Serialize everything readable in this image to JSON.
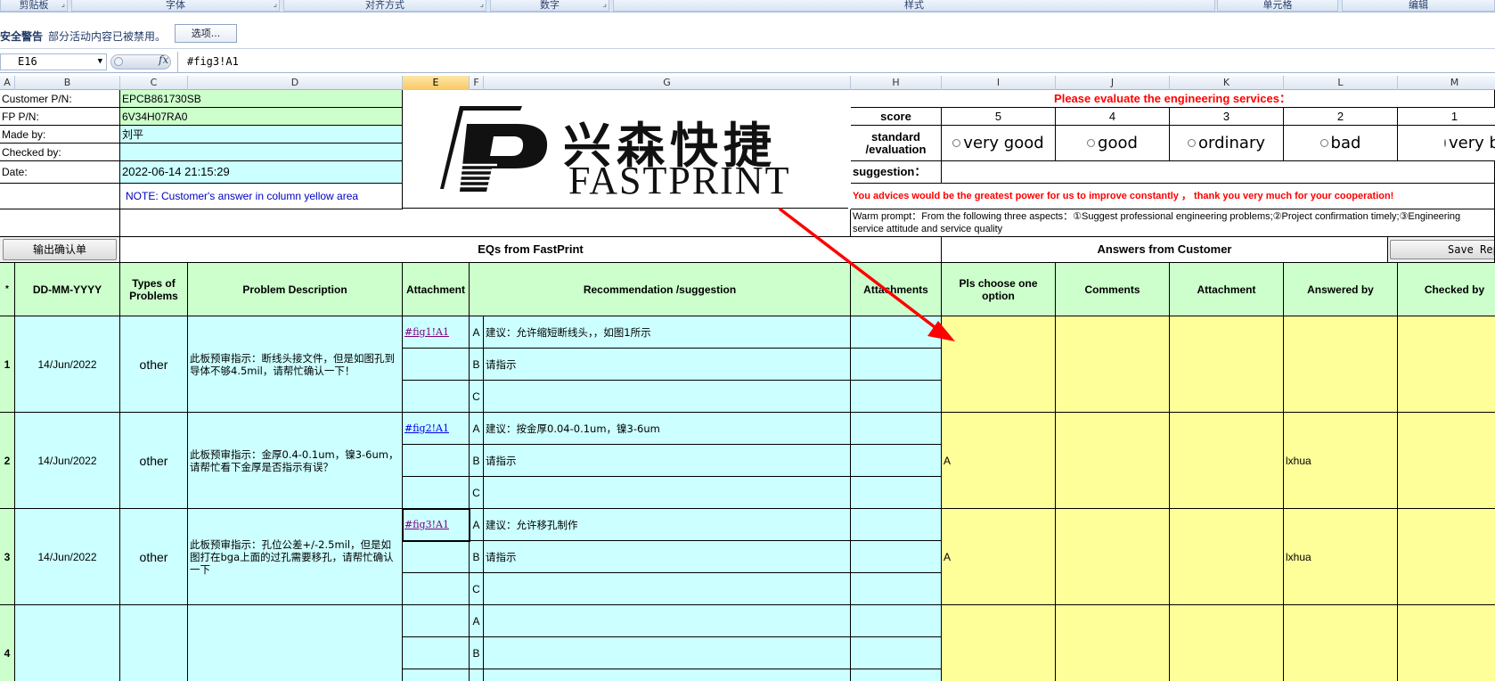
{
  "ribbon": {
    "groups": [
      "剪贴板",
      "字体",
      "对齐方式",
      "数字",
      "样式",
      "单元格",
      "编辑"
    ]
  },
  "security": {
    "title": "安全警告",
    "message": "部分活动内容已被禁用。",
    "options_label": "选项..."
  },
  "formula_bar": {
    "name_box": "E16",
    "fx": "fx",
    "formula": "#fig3!A1"
  },
  "columns": [
    "A",
    "B",
    "C",
    "D",
    "E",
    "F",
    "G",
    "H",
    "I",
    "J",
    "K",
    "L",
    "M"
  ],
  "selected_column": "E",
  "header_info": {
    "customer_pn_label": "Customer P/N:",
    "customer_pn": "EPCB861730SB",
    "fp_pn_label": "FP P/N:",
    "fp_pn": "6V34H07RA0",
    "made_by_label": "Made by:",
    "made_by": "刘平",
    "checked_by_label": "Checked by:",
    "checked_by": "",
    "date_label": "Date:",
    "date": "2022-06-14 21:15:29",
    "note": "NOTE: Customer's  answer in column yellow area"
  },
  "logo": {
    "zh": "兴森快捷",
    "en": "FASTPRINT"
  },
  "evaluation": {
    "title": "Please evaluate the engineering services：",
    "score_label": "score",
    "standard_label": "standard /evaluation",
    "scores": [
      "5",
      "4",
      "3",
      "2",
      "1"
    ],
    "options": [
      "very good",
      "good",
      "ordinary",
      "bad",
      "very bad"
    ],
    "suggestion_label": "suggestion：",
    "advice": "You advices would be the greatest power for us to improve constantly ， thank you very much for your cooperation!",
    "warm_prompt": "Warm prompt：From the following three aspects：①Suggest professional engineering problems;②Project confirmation timely;③Engineering service attitude and service quality"
  },
  "buttons": {
    "export": "输出确认单",
    "save_reply": "Save Reply"
  },
  "sections": {
    "eqs": "EQs from FastPrint",
    "answers": "Answers from Customer"
  },
  "table_headers": {
    "no": "*",
    "date": "DD-MM-YYYY",
    "types": "Types of Problems",
    "problem": "Problem Description",
    "attachment": "Attachment",
    "recommendation": "Recommendation /suggestion",
    "attachments": "Attachments",
    "choose": "Pls choose one option",
    "comments": "Comments",
    "attachment2": "Attachment",
    "answered_by": "Answered by",
    "checked_by": "Checked by"
  },
  "rows": [
    {
      "no": "1",
      "date": "14/Jun/2022",
      "type": "other",
      "problem": "此板预审指示：断线头接文件，但是如图孔到导体不够4.5mil，请帮忙确认一下！",
      "attachment": "#fig1!A1",
      "options": [
        {
          "letter": "A",
          "text": "建议：允许缩短断线头，，如图1所示"
        },
        {
          "letter": "B",
          "text": "请指示"
        },
        {
          "letter": "C",
          "text": ""
        }
      ],
      "choice": "",
      "answered_by": ""
    },
    {
      "no": "2",
      "date": "14/Jun/2022",
      "type": "other",
      "problem": "此板预审指示：金厚0.4-0.1um，镍3-6um，请帮忙看下金厚是否指示有误？",
      "attachment": "#fig2!A1",
      "options": [
        {
          "letter": "A",
          "text": "建议：按金厚0.04-0.1um，镍3-6um"
        },
        {
          "letter": "B",
          "text": "请指示"
        },
        {
          "letter": "C",
          "text": ""
        }
      ],
      "choice": "A",
      "answered_by": "lxhua"
    },
    {
      "no": "3",
      "date": "14/Jun/2022",
      "type": "other",
      "problem": "此板预审指示：孔位公差+/-2.5mil，但是如图打在bga上面的过孔需要移孔，请帮忙确认一下",
      "attachment": "#fig3!A1",
      "options": [
        {
          "letter": "A",
          "text": "建议：允许移孔制作"
        },
        {
          "letter": "B",
          "text": "请指示"
        },
        {
          "letter": "C",
          "text": ""
        }
      ],
      "choice": "A",
      "answered_by": "lxhua"
    },
    {
      "no": "4",
      "date": "",
      "type": "",
      "problem": "",
      "attachment": "",
      "options": [
        {
          "letter": "A",
          "text": ""
        },
        {
          "letter": "B",
          "text": ""
        },
        {
          "letter": "C",
          "text": ""
        }
      ],
      "choice": "",
      "answered_by": ""
    }
  ],
  "colors": {
    "green": "#ccffcc",
    "cyan": "#ccffff",
    "yellow": "#ffff99",
    "red": "#ff0000",
    "selection": "#f9c862"
  }
}
